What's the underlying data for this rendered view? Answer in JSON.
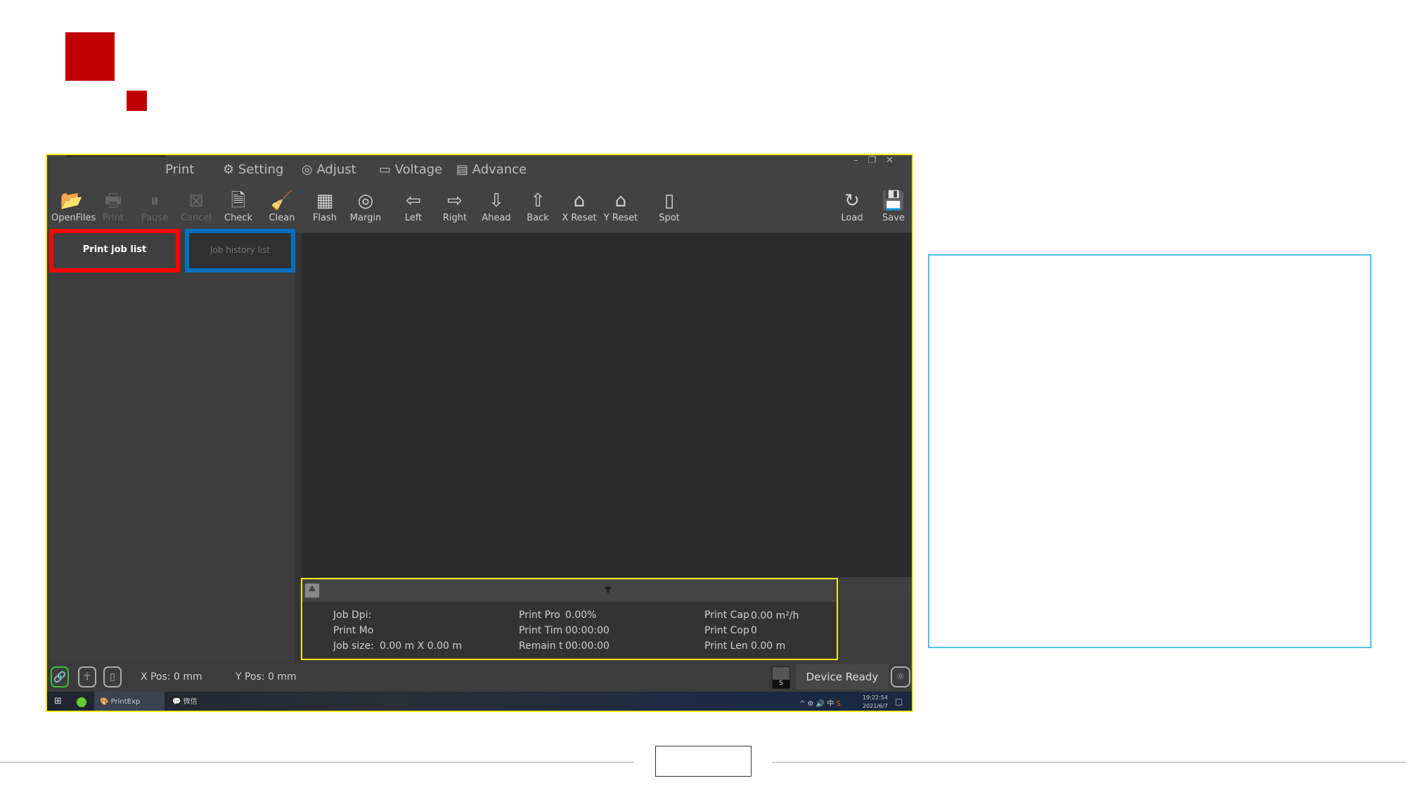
{
  "window": {
    "menu": [
      "Print",
      "Setting",
      "Adjust",
      "Voltage",
      "Advance"
    ],
    "window_controls": [
      "–",
      "❐",
      "✕"
    ],
    "toolbar": [
      {
        "label": "OpenFiles",
        "icon": "open-files-icon",
        "glyph": "📂",
        "disabled": false
      },
      {
        "label": "Print",
        "icon": "printer-icon",
        "glyph": "🖶",
        "disabled": true
      },
      {
        "label": "Pause",
        "icon": "pause-icon",
        "glyph": "⏸",
        "disabled": true
      },
      {
        "label": "Cancel",
        "icon": "cancel-icon",
        "glyph": "⊠",
        "disabled": true
      },
      {
        "label": "Check",
        "icon": "check-icon",
        "glyph": "🗎",
        "disabled": false
      },
      {
        "label": "Clean",
        "icon": "broom-icon",
        "glyph": "🧹",
        "disabled": false
      },
      {
        "label": "Flash",
        "icon": "grid-icon",
        "glyph": "▦",
        "disabled": false
      },
      {
        "label": "Margin",
        "icon": "target-icon",
        "glyph": "◎",
        "disabled": false
      },
      {
        "label": "Left",
        "icon": "arrow-left-icon",
        "glyph": "⇦",
        "disabled": false
      },
      {
        "label": "Right",
        "icon": "arrow-right-icon",
        "glyph": "⇨",
        "disabled": false
      },
      {
        "label": "Ahead",
        "icon": "arrow-down-icon",
        "glyph": "⇩",
        "disabled": false
      },
      {
        "label": "Back",
        "icon": "arrow-up-icon",
        "glyph": "⇧",
        "disabled": false
      },
      {
        "label": "X Reset",
        "icon": "home-icon",
        "glyph": "⌂",
        "disabled": false
      },
      {
        "label": "Y Reset",
        "icon": "home-icon",
        "glyph": "⌂",
        "disabled": false
      },
      {
        "label": "Spot",
        "icon": "spot-icon",
        "glyph": "▯",
        "disabled": false
      },
      {
        "label": "Load",
        "icon": "refresh-icon",
        "glyph": "↻",
        "disabled": false
      },
      {
        "label": "Save",
        "icon": "save-icon",
        "glyph": "💾",
        "disabled": false
      }
    ],
    "tabs": {
      "active": "Print job list",
      "inactive": "Job history list"
    },
    "info": {
      "job_dpi": "Job Dpi:",
      "print_mode": "Print Mo",
      "job_size_label": "Job size:",
      "job_size": "0.00 m X 0.00 m",
      "progress_label": "Print Pro",
      "progress": "0.00%",
      "time_label": "Print Tim",
      "time": "00:00:00",
      "remain_label": "Remain t",
      "remain": "00:00:00",
      "cap_label": "Print Cap",
      "cap": "0.00 m²/h",
      "copies_label": "Print Cop",
      "copies": "0",
      "len_label": "Print Len",
      "len": "0.00 m"
    },
    "status": {
      "xpos": "X Pos: 0 mm",
      "ypos": "Y Pos: 0 mm",
      "device": "Device Ready",
      "ink": "S"
    },
    "taskbar": {
      "app1": "PrintExp",
      "app2": "微信",
      "time": "19:22:54",
      "date": "2021/6/7"
    }
  },
  "colors": {
    "highlight_red": "#ff0000",
    "highlight_blue": "#0070c0",
    "highlight_yellow": "#f2ea1a",
    "accent_red": "#c00000",
    "callout_cyan": "#4fc3e8"
  }
}
